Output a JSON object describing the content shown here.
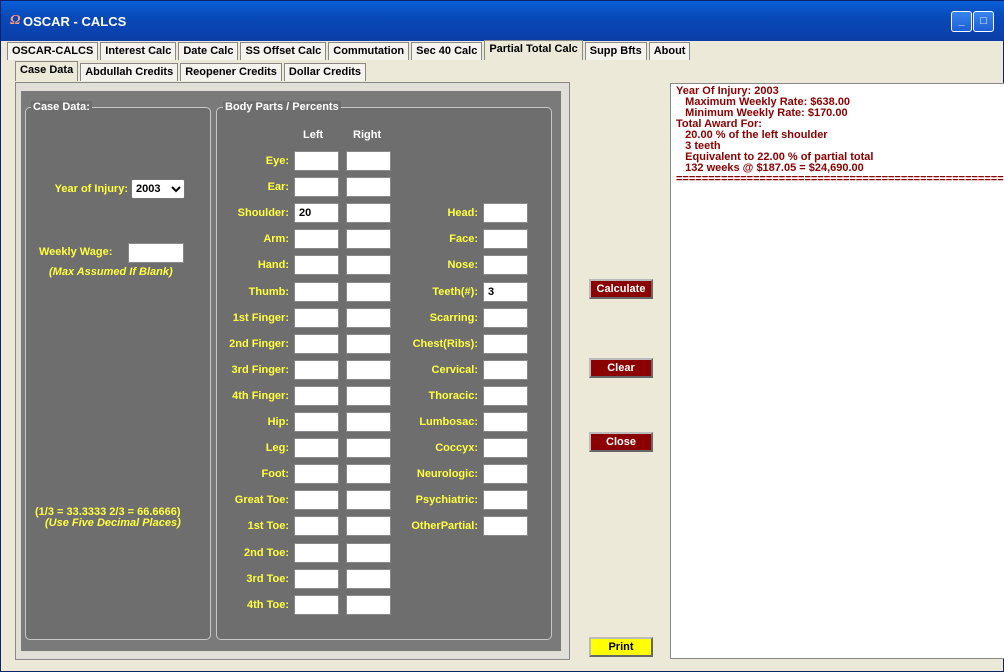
{
  "window": {
    "title": "OSCAR - CALCS"
  },
  "top_tabs": [
    "OSCAR-CALCS",
    "Interest Calc",
    "Date Calc",
    "SS Offset Calc",
    "Commutation",
    "Sec 40 Calc",
    "Partial Total Calc",
    "Supp Bfts",
    "About"
  ],
  "sub_tabs": [
    "Case Data",
    "Abdullah Credits",
    "Reopener Credits",
    "Dollar Credits"
  ],
  "case_data": {
    "title": "Case Data:",
    "year_label": "Year of Injury:",
    "year_value": "2003",
    "wage_label": "Weekly Wage:",
    "wage_value": "",
    "wage_note": "(Max Assumed If Blank)",
    "fraction_note": "(1/3 = 33.3333  2/3 = 66.6666)",
    "decimal_note": "(Use Five Decimal Places)"
  },
  "body_parts": {
    "title": "Body Parts / Percents",
    "left_header": "Left",
    "right_header": "Right",
    "bilateral": [
      {
        "label": "Eye:",
        "left": "",
        "right": ""
      },
      {
        "label": "Ear:",
        "left": "",
        "right": ""
      },
      {
        "label": "Shoulder:",
        "left": "20",
        "right": ""
      },
      {
        "label": "Arm:",
        "left": "",
        "right": ""
      },
      {
        "label": "Hand:",
        "left": "",
        "right": ""
      },
      {
        "label": "Thumb:",
        "left": "",
        "right": ""
      },
      {
        "label": "1st Finger:",
        "left": "",
        "right": ""
      },
      {
        "label": "2nd Finger:",
        "left": "",
        "right": ""
      },
      {
        "label": "3rd Finger:",
        "left": "",
        "right": ""
      },
      {
        "label": "4th Finger:",
        "left": "",
        "right": ""
      },
      {
        "label": "Hip:",
        "left": "",
        "right": ""
      },
      {
        "label": "Leg:",
        "left": "",
        "right": ""
      },
      {
        "label": "Foot:",
        "left": "",
        "right": ""
      },
      {
        "label": "Great Toe:",
        "left": "",
        "right": ""
      },
      {
        "label": "1st Toe:",
        "left": "",
        "right": ""
      },
      {
        "label": "2nd Toe:",
        "left": "",
        "right": ""
      },
      {
        "label": "3rd Toe:",
        "left": "",
        "right": ""
      },
      {
        "label": "4th Toe:",
        "left": "",
        "right": ""
      }
    ],
    "single": [
      {
        "label": "Head:",
        "value": ""
      },
      {
        "label": "Face:",
        "value": ""
      },
      {
        "label": "Nose:",
        "value": ""
      },
      {
        "label": "Teeth(#):",
        "value": "3"
      },
      {
        "label": "Scarring:",
        "value": ""
      },
      {
        "label": "Chest(Ribs):",
        "value": ""
      },
      {
        "label": "Cervical:",
        "value": ""
      },
      {
        "label": "Thoracic:",
        "value": ""
      },
      {
        "label": "Lumbosac:",
        "value": ""
      },
      {
        "label": "Coccyx:",
        "value": ""
      },
      {
        "label": "Neurologic:",
        "value": ""
      },
      {
        "label": "Psychiatric:",
        "value": ""
      },
      {
        "label": "OtherPartial:",
        "value": ""
      }
    ]
  },
  "buttons": {
    "calculate": "Calculate",
    "clear": "Clear",
    "close": "Close",
    "print": "Print"
  },
  "output": [
    "Year Of Injury: 2003",
    "   Maximum Weekly Rate: $638.00",
    "   Minimum Weekly Rate: $170.00",
    "Total Award For:",
    "   20.00 % of the left shoulder",
    "   3 teeth",
    "   Equivalent to 22.00 % of partial total",
    "   132 weeks @ $187.05 = $24,690.00",
    "======================================================="
  ],
  "colors": {
    "label": "#ffff40",
    "output_text": "#8b0000",
    "button": "#8b0000",
    "print_button": "#ffff00"
  }
}
